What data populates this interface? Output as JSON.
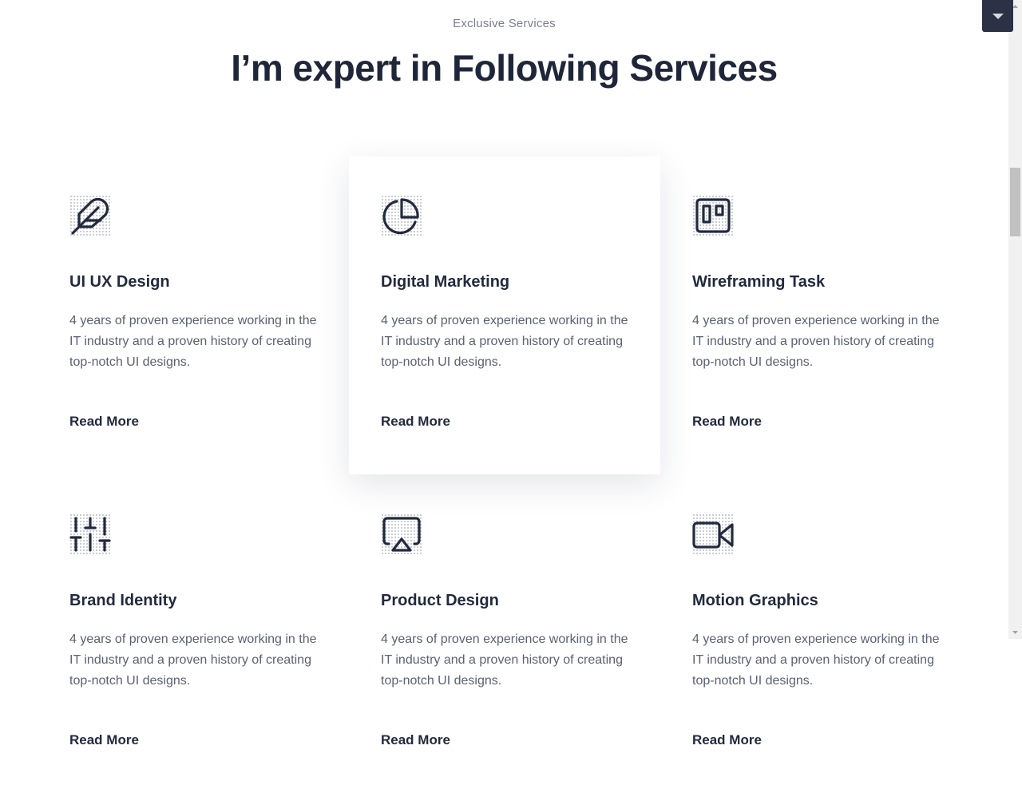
{
  "section": {
    "subtitle": "Exclusive Services",
    "title": "I’m expert in Following Services"
  },
  "services": [
    {
      "icon": "feather-icon",
      "title": "UI UX Design",
      "text": "4 years of proven experience working in the IT industry and a proven history of creating top-notch UI designs.",
      "link": "Read More"
    },
    {
      "icon": "pie-chart-icon",
      "title": "Digital Marketing",
      "text": "4 years of proven experience working in the IT industry and a proven history of creating top-notch UI designs.",
      "link": "Read More"
    },
    {
      "icon": "trello-board-icon",
      "title": "Wireframing Task",
      "text": "4 years of proven experience working in the IT industry and a proven history of creating top-notch UI designs.",
      "link": "Read More"
    },
    {
      "icon": "sliders-icon",
      "title": "Brand Identity",
      "text": "4 years of proven experience working in the IT industry and a proven history of creating top-notch UI designs.",
      "link": "Read More"
    },
    {
      "icon": "airplay-icon",
      "title": "Product Design",
      "text": "4 years of proven experience working in the IT industry and a proven history of creating top-notch UI designs.",
      "link": "Read More"
    },
    {
      "icon": "video-camera-icon",
      "title": "Motion Graphics",
      "text": "4 years of proven experience working in the IT industry and a proven history of creating top-notch UI designs.",
      "link": "Read More"
    }
  ],
  "colors": {
    "heading": "#1f2639",
    "text": "#5b6172",
    "accent_dark": "#2b3245"
  }
}
